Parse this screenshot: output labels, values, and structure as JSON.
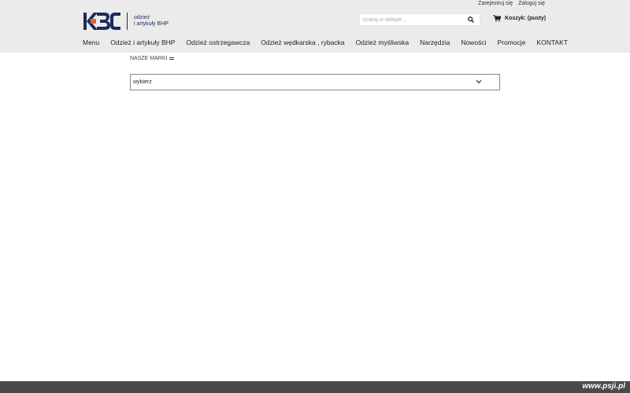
{
  "account": {
    "register": "Zarejestruj się",
    "login": "Zaloguj się"
  },
  "logo": {
    "tagline_line1": "odzież",
    "tagline_line2": "i artykuły BHP",
    "mark_color": "#1d2a5c",
    "accent_color": "#e8632a"
  },
  "search": {
    "placeholder": "szukaj w sklepie...",
    "icon": "search-icon"
  },
  "cart": {
    "label": "Koszyk: (pusty)",
    "icon": "cart-icon"
  },
  "nav": {
    "items": [
      {
        "label": "Menu"
      },
      {
        "label": "Odzież i artykuły BHP"
      },
      {
        "label": "Odzież ostrzegawcza"
      },
      {
        "label": "Odzież wędkarska , rybacka"
      },
      {
        "label": "Odzież myśliwska"
      },
      {
        "label": "Narzędzia"
      },
      {
        "label": "Nowości"
      },
      {
        "label": "Promocje"
      },
      {
        "label": "KONTAKT"
      }
    ]
  },
  "brands": {
    "label": "NASZE MARKI",
    "icon": "menu-icon"
  },
  "brand_select": {
    "value": "wybierz",
    "icon": "chevron-down-icon"
  },
  "watermark": "www.psji.pl"
}
